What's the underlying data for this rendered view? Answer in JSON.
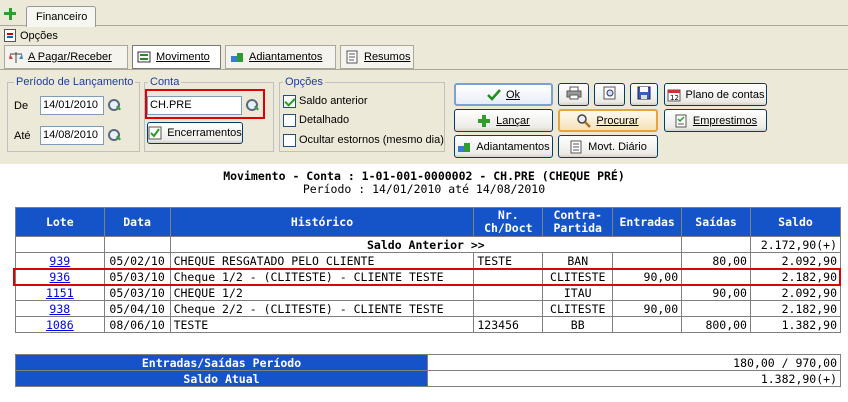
{
  "tabs": {
    "main": "Financeiro"
  },
  "menu": {
    "options": "Opções"
  },
  "subtabs": [
    {
      "label": "A Pagar/Receber",
      "icon": "scales-icon"
    },
    {
      "label": "Movimento",
      "icon": "movement-icon",
      "selected": true
    },
    {
      "label": "Adiantamentos",
      "icon": "boxes-icon"
    },
    {
      "label": "Resumos",
      "icon": "document-icon"
    }
  ],
  "period": {
    "title": "Período de Lançamento",
    "from_label": "De",
    "from_value": "14/01/2010",
    "to_label": "Até",
    "to_value": "14/08/2010"
  },
  "account": {
    "title": "Conta",
    "value": "CH.PRE",
    "closings_label": "Encerramentos"
  },
  "options": {
    "title": "Opções",
    "items": [
      {
        "label": "Saldo anterior",
        "checked": true
      },
      {
        "label": "Detalhado",
        "checked": false
      },
      {
        "label": "Ocultar estornos (mesmo dia)",
        "checked": false
      }
    ]
  },
  "buttons": {
    "ok": "Ok",
    "launch": "Lançar",
    "search": "Procurar",
    "advances": "Adiantamentos",
    "daily": "Movt. Diário",
    "chart_accounts": "Plano de contas",
    "loans": "Emprestimos"
  },
  "report": {
    "title": "Movimento - Conta : 1-01-001-0000002 - CH.PRE (CHEQUE PRÉ)",
    "subtitle": "Período : 14/01/2010 até 14/08/2010",
    "headers": {
      "lote": "Lote",
      "data": "Data",
      "historico": "Histórico",
      "nr1": "Nr.",
      "nr2": "Ch/Doct",
      "cp1": "Contra-",
      "cp2": "Partida",
      "entradas": "Entradas",
      "saidas": "Saídas",
      "saldo": "Saldo"
    },
    "opening": {
      "label": "Saldo Anterior >>",
      "saldo": "2.172,90(+)"
    },
    "rows": [
      {
        "lote": "939",
        "data": "05/02/10",
        "historico": "CHEQUE RESGATADO PELO CLIENTE",
        "nr": "TESTE",
        "cp": "BAN",
        "entradas": "",
        "saidas": "80,00",
        "saldo": "2.092,90"
      },
      {
        "lote": "936",
        "data": "05/03/10",
        "historico": "Cheque 1/2 - (CLITESTE) - CLIENTE TESTE",
        "nr": "",
        "cp": "CLITESTE",
        "entradas": "90,00",
        "saidas": "",
        "saldo": "2.182,90"
      },
      {
        "lote": "1151",
        "data": "05/03/10",
        "historico": "CHEQUE 1/2",
        "nr": "",
        "cp": "ITAU",
        "entradas": "",
        "saidas": "90,00",
        "saldo": "2.092,90"
      },
      {
        "lote": "938",
        "data": "05/04/10",
        "historico": "Cheque 2/2 - (CLITESTE) - CLIENTE TESTE",
        "nr": "",
        "cp": "CLITESTE",
        "entradas": "90,00",
        "saidas": "",
        "saldo": "2.182,90"
      },
      {
        "lote": "1086",
        "data": "08/06/10",
        "historico": "TESTE",
        "nr": "123456",
        "cp": "BB",
        "entradas": "",
        "saidas": "800,00",
        "saldo": "1.382,90"
      }
    ],
    "summary": [
      {
        "label": "Entradas/Saídas Período",
        "value": "180,00 / 970,00"
      },
      {
        "label": "Saldo Atual",
        "value": "1.382,90(+)"
      }
    ]
  },
  "colors": {
    "header_blue": "#1553c9",
    "highlight_red": "#e00000",
    "link_blue": "#0000ee"
  }
}
